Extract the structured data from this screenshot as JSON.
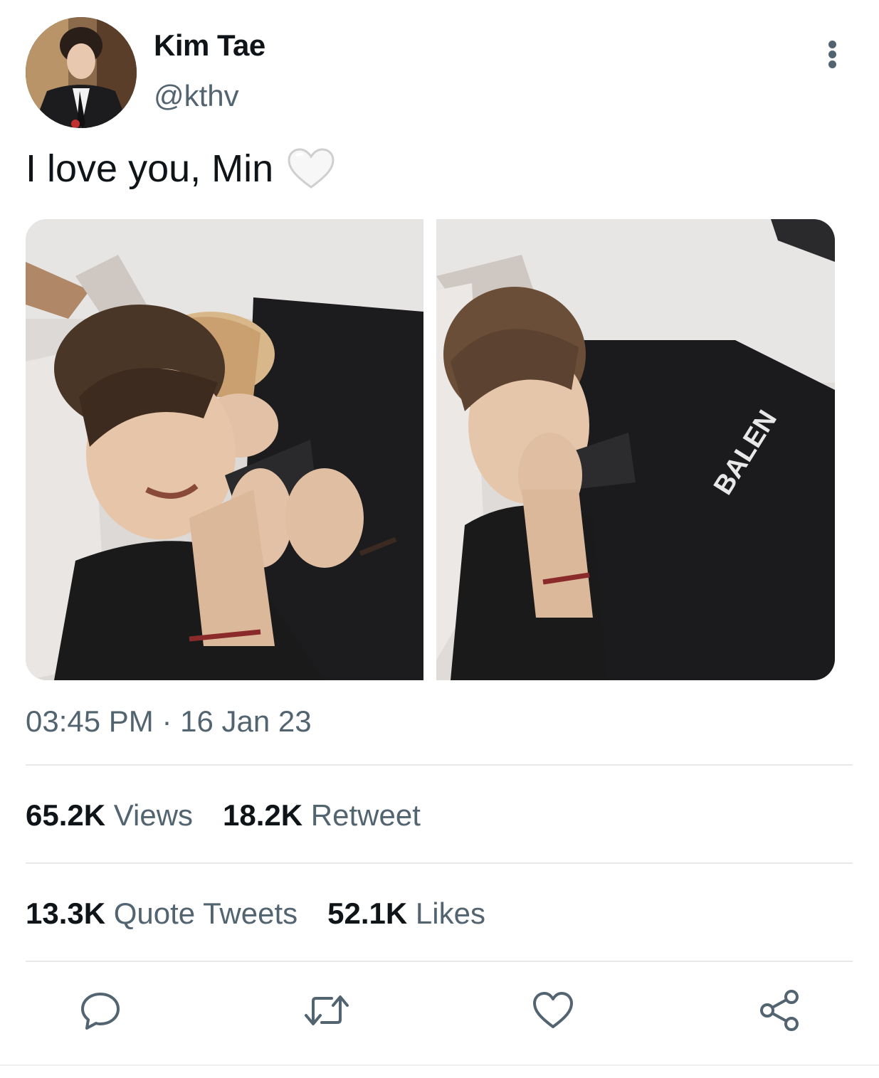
{
  "author": {
    "display_name": "Kim Tae",
    "handle": "@kthv"
  },
  "tweet": {
    "text": "I love you, Min",
    "emoji": "white-heart-emoji",
    "timestamp": "03:45 PM · 16 Jan 23"
  },
  "stats_row_1": [
    {
      "value": "65.2K",
      "label": "Views"
    },
    {
      "value": "18.2K",
      "label": "Retweet"
    }
  ],
  "stats_row_2": [
    {
      "value": "13.3K",
      "label": "Quote Tweets"
    },
    {
      "value": "52.1K",
      "label": "Likes"
    }
  ],
  "actions": [
    "reply-icon",
    "retweet-icon",
    "like-icon",
    "share-icon"
  ],
  "colors": {
    "text_primary": "#0f1419",
    "text_secondary": "#536471",
    "divider": "#e6e8ea"
  }
}
